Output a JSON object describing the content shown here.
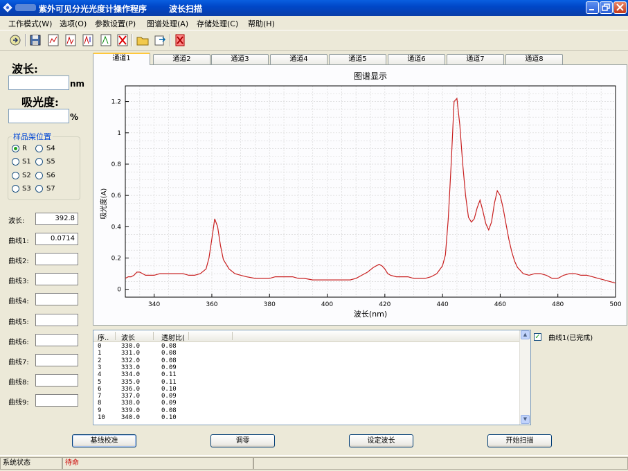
{
  "window": {
    "title": "紫外可见分光光度计操作程序",
    "mode_title": "波长扫描"
  },
  "menu": [
    "工作模式(W)",
    "选项(O)",
    "参数设置(P)",
    "图谱处理(A)",
    "存储处理(C)",
    "帮助(H)"
  ],
  "toolbar_icons": [
    "exit-icon",
    "save-icon",
    "open-chart-icon",
    "spectrum-icon",
    "spectrum-peak-icon",
    "spectrum-mark-icon",
    "delete-chart-icon",
    "open-file-icon",
    "export-icon",
    "delete-file-icon"
  ],
  "left": {
    "wavelength_label": "波长:",
    "wavelength_unit": "nm",
    "wavelength_value": "",
    "absorbance_label": "吸光度:",
    "absorbance_unit": "%",
    "absorbance_value": "",
    "holder_title": "样品架位置",
    "holder_positions": [
      "R",
      "S4",
      "S1",
      "S5",
      "S2",
      "S6",
      "S3",
      "S7"
    ],
    "holder_selected": "R",
    "readouts": [
      {
        "label": "波长:",
        "value": "392.8"
      },
      {
        "label": "曲线1:",
        "value": "0.0714"
      },
      {
        "label": "曲线2:",
        "value": ""
      },
      {
        "label": "曲线3:",
        "value": ""
      },
      {
        "label": "曲线4:",
        "value": ""
      },
      {
        "label": "曲线5:",
        "value": ""
      },
      {
        "label": "曲线6:",
        "value": ""
      },
      {
        "label": "曲线7:",
        "value": ""
      },
      {
        "label": "曲线8:",
        "value": ""
      },
      {
        "label": "曲线9:",
        "value": ""
      }
    ]
  },
  "tabs": [
    "通道1",
    "通道2",
    "通道3",
    "通道4",
    "通道5",
    "通道6",
    "通道7",
    "通道8"
  ],
  "active_tab": 0,
  "chart_data": {
    "type": "line",
    "title": "图谱显示",
    "xlabel": "波长(nm)",
    "ylabel": "吸光度(A)",
    "xlim": [
      330,
      500
    ],
    "ylim": [
      -0.05,
      1.3
    ],
    "xticks": [
      340,
      360,
      380,
      400,
      420,
      440,
      460,
      480,
      500
    ],
    "yticks": [
      0,
      0.2,
      0.4,
      0.6,
      0.8,
      1.0,
      1.2
    ],
    "ytick_labels": [
      "0",
      "0.2",
      "0.4",
      "0.6",
      "0.8",
      "1",
      "1.2"
    ],
    "grid": true,
    "line_color": "#c81e1e",
    "series": [
      {
        "x": [
          330,
          331,
          332,
          333,
          334,
          335,
          336,
          337,
          338,
          340,
          342,
          344,
          346,
          348,
          350,
          352,
          354,
          356,
          358,
          359,
          360,
          361,
          362,
          363,
          364,
          366,
          368,
          370,
          372,
          375,
          378,
          380,
          382,
          384,
          386,
          388,
          390,
          392,
          395,
          398,
          400,
          402,
          405,
          408,
          410,
          412,
          414,
          416,
          418,
          419,
          420,
          421,
          422,
          424,
          426,
          428,
          430,
          432,
          434,
          436,
          438,
          440,
          441,
          442,
          443,
          444,
          445,
          446,
          447,
          448,
          449,
          450,
          451,
          452,
          453,
          454,
          455,
          456,
          457,
          458,
          459,
          460,
          461,
          462,
          463,
          464,
          465,
          466,
          467,
          468,
          470,
          472,
          474,
          476,
          478,
          480,
          482,
          484,
          486,
          488,
          490,
          492,
          494,
          496,
          498,
          500
        ],
        "y": [
          0.07,
          0.08,
          0.08,
          0.09,
          0.11,
          0.11,
          0.1,
          0.09,
          0.09,
          0.09,
          0.1,
          0.1,
          0.1,
          0.1,
          0.1,
          0.09,
          0.09,
          0.1,
          0.13,
          0.2,
          0.32,
          0.45,
          0.4,
          0.28,
          0.19,
          0.13,
          0.1,
          0.09,
          0.08,
          0.07,
          0.07,
          0.07,
          0.08,
          0.08,
          0.08,
          0.08,
          0.07,
          0.07,
          0.06,
          0.06,
          0.06,
          0.06,
          0.06,
          0.06,
          0.07,
          0.09,
          0.11,
          0.14,
          0.16,
          0.15,
          0.13,
          0.1,
          0.09,
          0.08,
          0.08,
          0.08,
          0.07,
          0.07,
          0.07,
          0.08,
          0.1,
          0.15,
          0.22,
          0.45,
          0.8,
          1.2,
          1.22,
          1.05,
          0.8,
          0.6,
          0.46,
          0.43,
          0.45,
          0.52,
          0.57,
          0.5,
          0.42,
          0.38,
          0.43,
          0.55,
          0.63,
          0.6,
          0.52,
          0.42,
          0.32,
          0.24,
          0.18,
          0.14,
          0.12,
          0.1,
          0.09,
          0.1,
          0.1,
          0.09,
          0.07,
          0.07,
          0.09,
          0.1,
          0.1,
          0.09,
          0.09,
          0.08,
          0.07,
          0.06,
          0.05,
          0.04
        ]
      }
    ]
  },
  "table": {
    "columns": [
      "序..",
      "波长",
      "透射比(",
      "",
      ""
    ],
    "rows": [
      [
        "0",
        "330.0",
        "0.08"
      ],
      [
        "1",
        "331.0",
        "0.08"
      ],
      [
        "2",
        "332.0",
        "0.08"
      ],
      [
        "3",
        "333.0",
        "0.09"
      ],
      [
        "4",
        "334.0",
        "0.11"
      ],
      [
        "5",
        "335.0",
        "0.11"
      ],
      [
        "6",
        "336.0",
        "0.10"
      ],
      [
        "7",
        "337.0",
        "0.09"
      ],
      [
        "8",
        "338.0",
        "0.09"
      ],
      [
        "9",
        "339.0",
        "0.08"
      ],
      [
        "10",
        "340.0",
        "0.10"
      ]
    ]
  },
  "curve_legend": {
    "checked": true,
    "label": "曲线1(已完成)"
  },
  "buttons": {
    "baseline": "基线校准",
    "zero": "调零",
    "set_wavelength": "设定波长",
    "start_scan": "开始扫描"
  },
  "status": {
    "label": "系统状态",
    "value": "待命",
    "value_color": "#cc0000"
  }
}
